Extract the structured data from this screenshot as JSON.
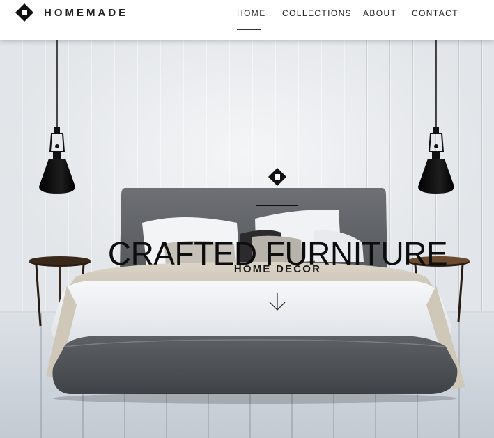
{
  "brand": {
    "name": "HOMEMADE"
  },
  "nav": {
    "items": [
      {
        "label": "HOME",
        "active": true
      },
      {
        "label": "COLLECTIONS",
        "active": false
      },
      {
        "label": "ABOUT",
        "active": false
      },
      {
        "label": "CONTACT",
        "active": false
      }
    ]
  },
  "hero": {
    "headline": "CRAFTED FURNITURE",
    "subheadline": "HOME DECOR",
    "scroll_icon": "arrow-down-icon",
    "logo_icon": "diamond-logo-icon"
  },
  "colors": {
    "text": "#111111",
    "header_bg": "#ffffff",
    "accent_underline": "#333333"
  }
}
